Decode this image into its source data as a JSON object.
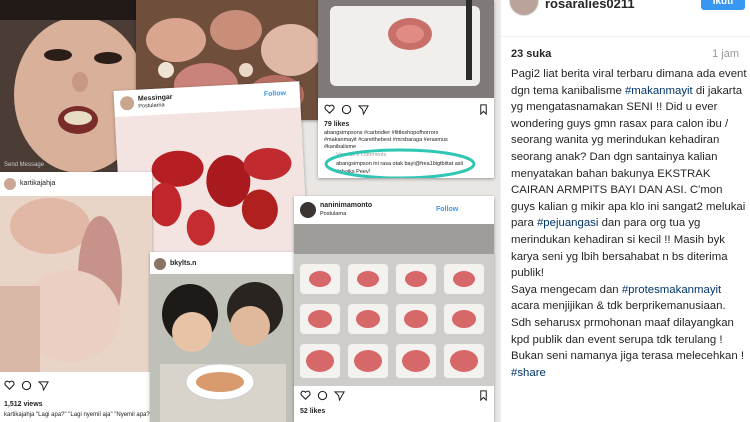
{
  "post": {
    "username": "rosaralies0211",
    "follow_label": "Ikuti",
    "likes": "23 suka",
    "time": "1 jam",
    "caption": [
      {
        "t": "text",
        "v": "Pagi2 liat berita viral terbaru dimana ada event dgn tema kanibalisme "
      },
      {
        "t": "tag",
        "v": "#makanmayit"
      },
      {
        "t": "text",
        "v": " di jakarta yg mengatasnamakan SENI !! Did u ever wondering guys gmn rasax para calon ibu / seorang wanita yg merindukan kehadiran seorang anak? Dan dgn santainya kalian menyatakan bahan bakunya EKSTRAK CAIRAN ARMPITS BAYI DAN ASI. C'mon guys kalian g mikir apa klo ini sangat2 melukai para "
      },
      {
        "t": "tag",
        "v": "#pejuangasi"
      },
      {
        "t": "text",
        "v": " dan para org tua yg merindukan kehadiran si kecil !! Masih byk karya seni yg lbih bersahabat n bs diterima publik!\nSaya mengecam dan "
      },
      {
        "t": "tag",
        "v": "#protesmakanmayit"
      },
      {
        "t": "text",
        "v": " acara menjijikan & tdk berprikemanusiaan. Sdh seharusx prmohonan maaf dilayangkan kpd publik dan event serupa tdk terulang ! Bukan seni namanya jiga terasa melecehkan !\n"
      },
      {
        "t": "tag",
        "v": "#share"
      }
    ]
  },
  "collage": {
    "top_left": {
      "send_message": "Send Message"
    },
    "middle_card": {
      "username": "Messingar",
      "location": "Postularna",
      "follow": "Follow"
    },
    "top_right_card": {
      "likes": "79 likes",
      "line1": "abangsimpsons #carbodier #littleshopofhorrors",
      "line2": "#makanmayit #careithebest #mrsbaraga #erasmus",
      "line3": "#kanibalisme",
      "comments": "View all 6 comments",
      "highlight": "abangsimpson ini rasa otak bayi@frea1bigtbiitat asli",
      "reply": "bar.haloo.Yesh",
      "reply2": "#chaiks Peev!"
    },
    "left_card": {
      "username": "kartikajahja"
    },
    "bottom_left": {
      "views": "1,512 views",
      "comment": "kartikajahja \"Lagi apa?\" \"Lagi nyemil aja\" \"Nyemil apa?\""
    },
    "middle_bottom": {
      "username": "bkylts.n"
    },
    "right_card": {
      "username": "naninimamonto",
      "location": "Postularna",
      "follow": "Follow",
      "likes": "52 likes"
    }
  },
  "colors": {
    "follow_bg": "#3897f0",
    "hashtag": "#003569",
    "highlight_circle": "#2fc6b3"
  }
}
